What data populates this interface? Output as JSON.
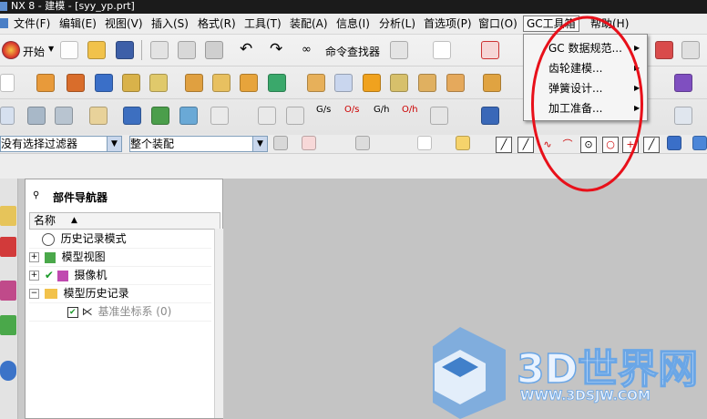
{
  "window": {
    "title": "NX 8 - 建模 - [syy_yp.prt]"
  },
  "menubar": {
    "items": [
      {
        "label": "文件(F)"
      },
      {
        "label": "编辑(E)"
      },
      {
        "label": "视图(V)"
      },
      {
        "label": "插入(S)"
      },
      {
        "label": "格式(R)"
      },
      {
        "label": "工具(T)"
      },
      {
        "label": "装配(A)"
      },
      {
        "label": "信息(I)"
      },
      {
        "label": "分析(L)"
      },
      {
        "label": "首选项(P)"
      },
      {
        "label": "窗口(O)"
      },
      {
        "label": "GC工具箱"
      },
      {
        "label": "帮助(H)"
      }
    ]
  },
  "toolbar": {
    "start_label": "开始",
    "command_finder_label": "命令查找器"
  },
  "selection_bar": {
    "filter_value": "没有选择过滤器",
    "scope_value": "整个装配"
  },
  "dropdown": {
    "items": [
      {
        "label": "GC 数据规范..."
      },
      {
        "label": "齿轮建模..."
      },
      {
        "label": "弹簧设计..."
      },
      {
        "label": "加工准备..."
      }
    ]
  },
  "navigator": {
    "title": "部件导航器",
    "column_header": "名称",
    "rows": [
      {
        "label": "历史记录模式"
      },
      {
        "label": "模型视图"
      },
      {
        "label": "摄像机"
      },
      {
        "label": "模型历史记录"
      },
      {
        "label": "基准坐标系 (0)"
      }
    ]
  },
  "watermark": {
    "brand": "3D世界网",
    "url": "WWW.3DSJW.COM"
  },
  "colors": {
    "highlight_red": "#e8101a",
    "accent_blue": "#2f73c4"
  }
}
